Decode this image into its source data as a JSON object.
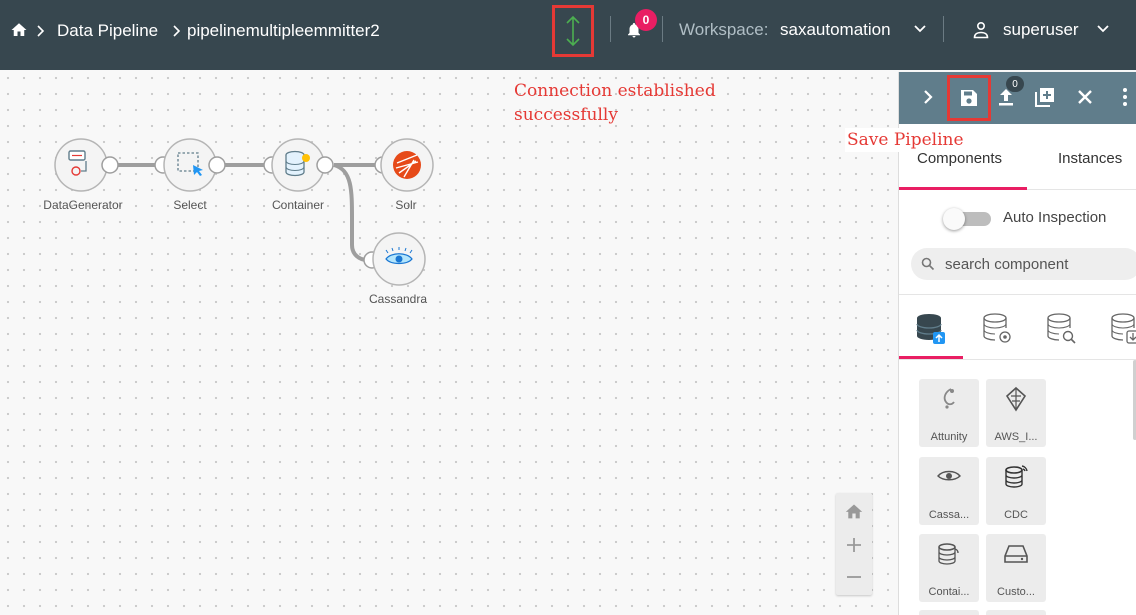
{
  "header": {
    "breadcrumb_root": "Data Pipeline",
    "breadcrumb_current": "pipelinemultipleemmitter2",
    "notification_count": "0",
    "workspace_label": "Workspace:",
    "workspace_value": "saxautomation",
    "user_name": "superuser"
  },
  "annotations": {
    "connection_line1": "Connection established",
    "connection_line2": "successfully",
    "save_pipeline": "Save Pipeline"
  },
  "pipeline": {
    "nodes": [
      {
        "label": "DataGenerator",
        "icon": "data-generator-icon"
      },
      {
        "label": "Select",
        "icon": "select-icon"
      },
      {
        "label": "Container",
        "icon": "container-icon"
      },
      {
        "label": "Solr",
        "icon": "solr-icon"
      },
      {
        "label": "Cassandra",
        "icon": "cassandra-icon"
      }
    ]
  },
  "panel": {
    "toolbar_badge": "0",
    "tabs": [
      "Components",
      "Instances"
    ],
    "auto_inspection_label": "Auto Inspection",
    "auto_inspection_on": false,
    "search_placeholder": "search component",
    "components": [
      {
        "label": "Attunity",
        "icon": "attunity-icon"
      },
      {
        "label": "AWS_I...",
        "icon": "aws-iot-icon"
      },
      {
        "label": "Cassa...",
        "icon": "cassandra-icon"
      },
      {
        "label": "CDC",
        "icon": "cdc-icon"
      },
      {
        "label": "Contai...",
        "icon": "container-icon"
      },
      {
        "label": "Custo...",
        "icon": "custom-icon"
      }
    ]
  },
  "colors": {
    "topbar": "#37474f",
    "panel_toolbar": "#607d8b",
    "accent": "#e91e63",
    "annotation": "#e53935",
    "connection_icon": "#4caf50"
  }
}
